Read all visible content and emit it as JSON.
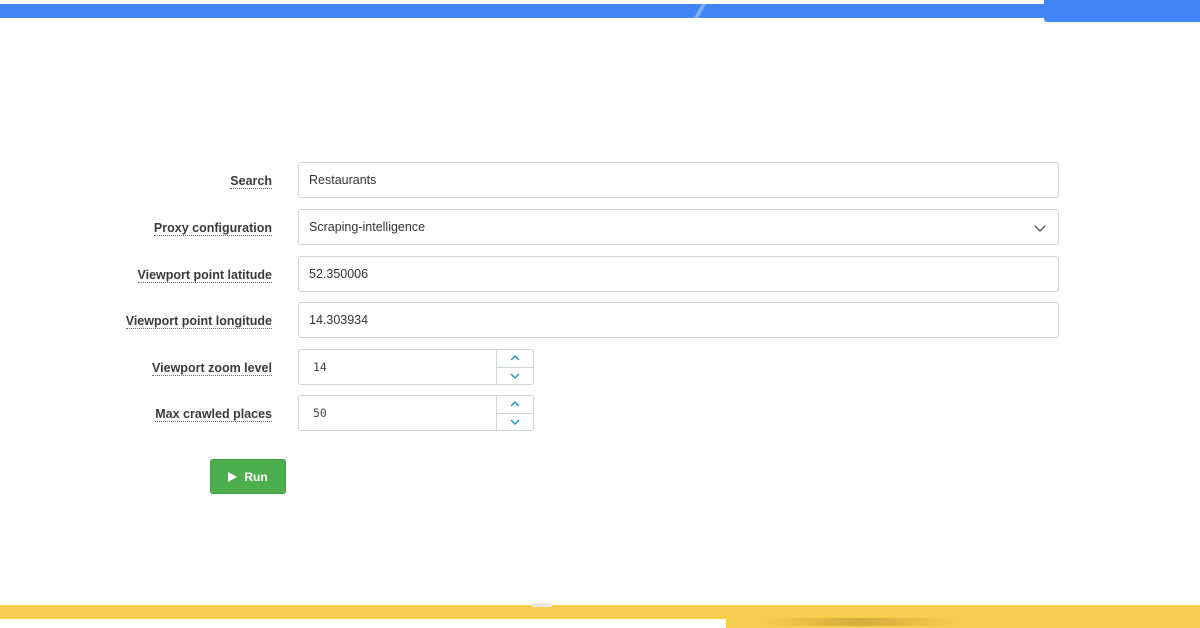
{
  "colors": {
    "top_accent": "#4285f4",
    "bottom_accent": "#f7cc4f",
    "run_button": "#4cae4c",
    "stepper_arrow": "#2196c9"
  },
  "form": {
    "search": {
      "label": "Search",
      "value": "Restaurants"
    },
    "proxy": {
      "label": "Proxy configuration",
      "value": "Scraping-intelligence",
      "icon": "chevron-down-icon"
    },
    "latitude": {
      "label": "Viewport point latitude",
      "value": "52.350006"
    },
    "longitude": {
      "label": "Viewport point longitude",
      "value": "14.303934"
    },
    "zoom": {
      "label": "Viewport zoom level",
      "value": "14"
    },
    "max_places": {
      "label": "Max crawled places",
      "value": "50"
    }
  },
  "run": {
    "label": "Run",
    "icon": "play-icon"
  }
}
